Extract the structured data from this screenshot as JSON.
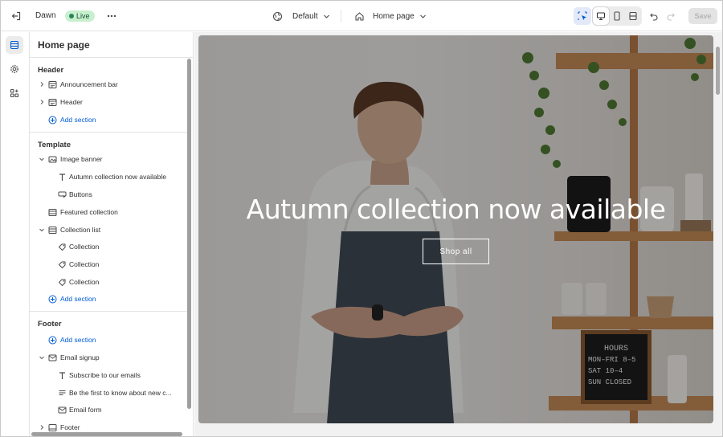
{
  "topbar": {
    "store_name": "Dawn",
    "live_label": "Live",
    "theme_label": "Default",
    "page_label": "Home page",
    "save_label": "Save"
  },
  "sidebar": {
    "title": "Home page",
    "header_group": {
      "label": "Header",
      "items": [
        {
          "label": "Announcement bar",
          "icon": "layout-icon"
        },
        {
          "label": "Header",
          "icon": "layout-icon"
        }
      ],
      "add_label": "Add section"
    },
    "template_group": {
      "label": "Template",
      "image_banner": "Image banner",
      "banner_children": [
        "Autumn collection now available",
        "Buttons"
      ],
      "featured_collection": "Featured collection",
      "collection_list": "Collection list",
      "collection_children": [
        "Collection",
        "Collection",
        "Collection"
      ],
      "add_label": "Add section"
    },
    "footer_group": {
      "label": "Footer",
      "add_label": "Add section",
      "email_signup": "Email signup",
      "email_children": [
        "Subscribe to our emails",
        "Be the first to know about new c...",
        "Email form"
      ],
      "footer": "Footer"
    }
  },
  "preview": {
    "banner_heading": "Autumn collection now available",
    "button_label": "Shop all",
    "sign_lines": [
      "HOURS",
      "MON–FRI 8–5",
      "SAT      10–4",
      "SUN     CLOSED"
    ]
  },
  "colors": {
    "accent": "#005bd3",
    "live_badge_bg": "#c8f0cf",
    "live_badge_text": "#0c5132"
  }
}
